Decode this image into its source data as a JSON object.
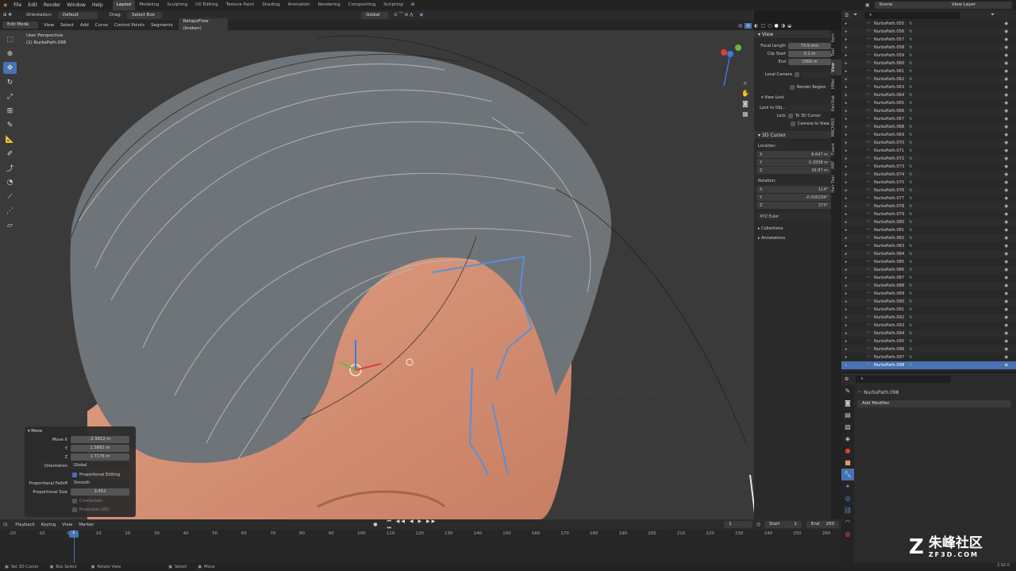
{
  "menu": [
    "File",
    "Edit",
    "Render",
    "Window",
    "Help"
  ],
  "workspaces": [
    "Layout",
    "Modeling",
    "Sculpting",
    "UV Editing",
    "Texture Paint",
    "Shading",
    "Animation",
    "Rendering",
    "Compositing",
    "Scripting"
  ],
  "active_workspace": "Layout",
  "scene": "Scene",
  "view_layer": "View Layer",
  "header": {
    "orientation_label": "Orientation:",
    "orientation_value": "Default",
    "drag_label": "Drag:",
    "drag_value": "Select Box",
    "transform_orient": "Global"
  },
  "header3": {
    "mode": "Edit Mode",
    "items": [
      "View",
      "Select",
      "Add",
      "Curve",
      "Control Points",
      "Segments"
    ],
    "addon": "RetopoFlow (broken)"
  },
  "viewport": {
    "perspective": "User Perspective",
    "object": "(1) NurbsPath.098"
  },
  "npanel": {
    "view_title": "View",
    "focal_length_label": "Focal Length",
    "focal_length": "73.9 mm",
    "clip_start_label": "Clip Start",
    "clip_start": "0.1 m",
    "end_label": "End",
    "end": "1000 m",
    "local_camera_label": "Local Camera",
    "render_region": "Render Region",
    "view_lock": "View Lock",
    "lock_to_obj": "Lock to Obj...",
    "lock_label": "Lock",
    "to_3d_cursor": "To 3D Cursor",
    "camera_to_view": "Camera to View",
    "cursor_title": "3D Cursor",
    "location_label": "Location:",
    "loc_x": "8.647 m",
    "loc_y": "0.2838 m",
    "loc_z": "29.87 m",
    "rotation_label": "Rotation:",
    "rot_x": "114°",
    "rot_y": "-0.000234°",
    "rot_z": "373°",
    "rot_mode": "XYZ Euler",
    "collections": "Collections",
    "annotations": "Annotations",
    "tabs": [
      "Item",
      "Tool",
      "View",
      "HMet",
      "HairStat",
      "MACHIN3",
      "Fluent",
      "ARP",
      "Hair Tool"
    ]
  },
  "outliner": {
    "items": [
      "NurbsPath.055",
      "NurbsPath.056",
      "NurbsPath.057",
      "NurbsPath.058",
      "NurbsPath.059",
      "NurbsPath.060",
      "NurbsPath.061",
      "NurbsPath.062",
      "NurbsPath.063",
      "NurbsPath.064",
      "NurbsPath.065",
      "NurbsPath.066",
      "NurbsPath.067",
      "NurbsPath.068",
      "NurbsPath.069",
      "NurbsPath.070",
      "NurbsPath.071",
      "NurbsPath.072",
      "NurbsPath.073",
      "NurbsPath.074",
      "NurbsPath.075",
      "NurbsPath.076",
      "NurbsPath.077",
      "NurbsPath.078",
      "NurbsPath.079",
      "NurbsPath.080",
      "NurbsPath.081",
      "NurbsPath.082",
      "NurbsPath.083",
      "NurbsPath.084",
      "NurbsPath.085",
      "NurbsPath.086",
      "NurbsPath.087",
      "NurbsPath.088",
      "NurbsPath.089",
      "NurbsPath.090",
      "NurbsPath.091",
      "NurbsPath.092",
      "NurbsPath.093",
      "NurbsPath.094",
      "NurbsPath.095",
      "NurbsPath.096",
      "NurbsPath.097",
      "NurbsPath.098"
    ],
    "selected": "NurbsPath.098"
  },
  "properties": {
    "object": "NurbsPath.098",
    "add_modifier": "Add Modifier"
  },
  "op_panel": {
    "title": "Move",
    "move_x_label": "Move X",
    "move_x": "-2.9912 m",
    "y_label": "Y",
    "move_y": "1.5862 m",
    "z_label": "Z",
    "move_z": "1.7176 m",
    "orientation_label": "Orientation",
    "orientation": "Global",
    "proportional_editing": "Proportional Editing",
    "falloff_label": "Proportional Falloff",
    "falloff": "Smooth",
    "size_label": "Proportional Size",
    "size": "3.452",
    "connected": "Connected",
    "projected": "Projected (2D)"
  },
  "timeline": {
    "menu": [
      "Playback",
      "Keying",
      "View",
      "Marker"
    ],
    "current_frame": "1",
    "start_label": "Start",
    "start": "1",
    "end_label": "End",
    "end": "250",
    "ticks": [
      "-20",
      "-10",
      "0",
      "10",
      "20",
      "30",
      "40",
      "50",
      "60",
      "70",
      "80",
      "90",
      "100",
      "110",
      "120",
      "130",
      "140",
      "150",
      "160",
      "170",
      "180",
      "190",
      "200",
      "210",
      "220",
      "230",
      "240",
      "250",
      "260"
    ],
    "playhead": "1"
  },
  "status": {
    "items": [
      "Set 3D Cursor",
      "Box Select",
      "Rotate View",
      "Select",
      "Move"
    ],
    "version": "2.92.0"
  },
  "watermark": {
    "cn": "朱峰社区",
    "site": "ZF3D.COM"
  },
  "colors": {
    "accent": "#4772b3",
    "skin": "#d59478",
    "hair": "#6f7478",
    "grid_bg": "#3a3a3a"
  }
}
